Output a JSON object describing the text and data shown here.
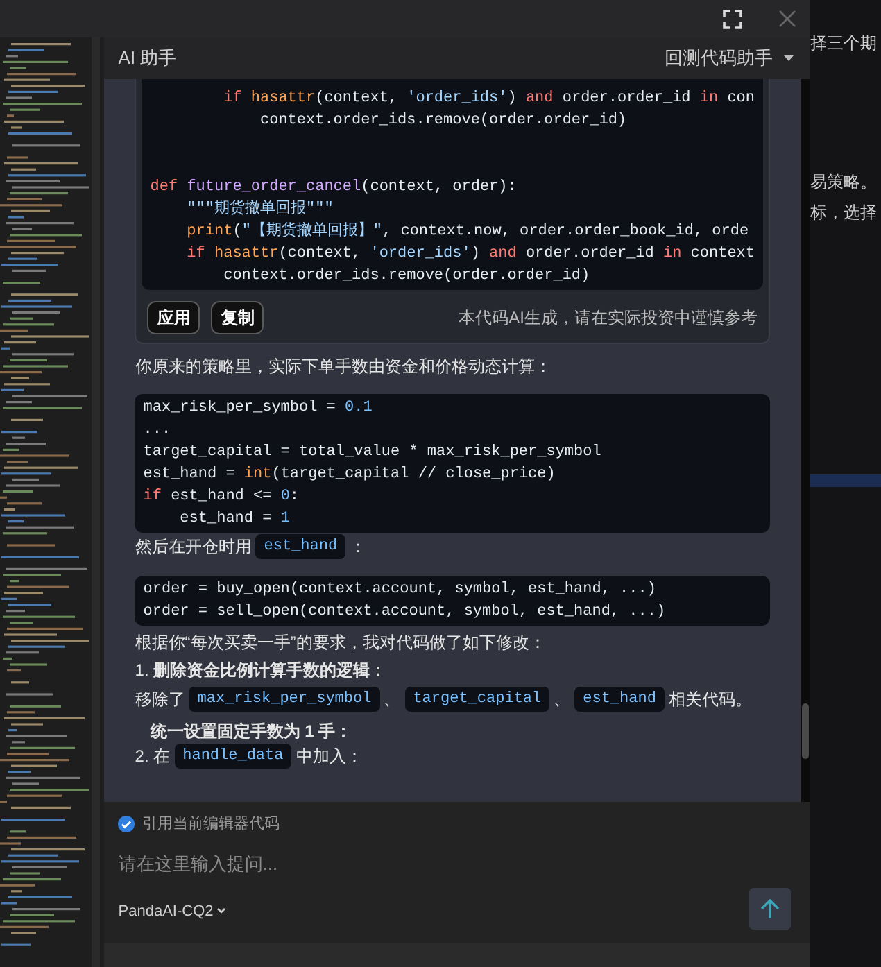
{
  "panel": {
    "title": "AI 助手",
    "mode_dropdown": "回测代码助手"
  },
  "messages": [
    {
      "kind": "code_card",
      "lines": [
        {
          "kind": "code",
          "tokens": [
            {
              "kind": "kw",
              "t": "        if"
            },
            {
              "kind": "builtin",
              "t": " hasattr"
            },
            {
              "kind": "plain",
              "t": "(context, "
            },
            {
              "kind": "str",
              "t": "'order_ids'"
            },
            {
              "kind": "plain",
              "t": ") "
            },
            {
              "kind": "kw",
              "t": "and"
            },
            {
              "kind": "plain",
              "t": " order.order_id "
            },
            {
              "kind": "kw",
              "t": "in"
            },
            {
              "kind": "plain",
              "t": " con"
            }
          ]
        },
        {
          "kind": "code",
          "tokens": [
            {
              "kind": "plain",
              "t": "            context.order_ids.remove(order.order_id)"
            }
          ]
        },
        {
          "kind": "blank"
        },
        {
          "kind": "blank"
        },
        {
          "kind": "code",
          "tokens": [
            {
              "kind": "kw",
              "t": "def"
            },
            {
              "kind": "fn",
              "t": " future_order_cancel"
            },
            {
              "kind": "plain",
              "t": "(context, order):"
            }
          ]
        },
        {
          "kind": "code",
          "tokens": [
            {
              "kind": "str",
              "t": "    \"\"\"期货撤单回报\"\"\""
            }
          ]
        },
        {
          "kind": "code",
          "tokens": [
            {
              "kind": "builtin",
              "t": "    print"
            },
            {
              "kind": "plain",
              "t": "("
            },
            {
              "kind": "str",
              "t": "\"【期货撤单回报】\""
            },
            {
              "kind": "plain",
              "t": ", context.now, order.order_book_id, orde"
            }
          ]
        },
        {
          "kind": "code",
          "tokens": [
            {
              "kind": "kw",
              "t": "    if"
            },
            {
              "kind": "builtin",
              "t": " hasattr"
            },
            {
              "kind": "plain",
              "t": "(context, "
            },
            {
              "kind": "str",
              "t": "'order_ids'"
            },
            {
              "kind": "plain",
              "t": ") "
            },
            {
              "kind": "kw",
              "t": "and"
            },
            {
              "kind": "plain",
              "t": " order.order_id "
            },
            {
              "kind": "kw",
              "t": "in"
            },
            {
              "kind": "plain",
              "t": " context"
            }
          ]
        },
        {
          "kind": "code",
          "tokens": [
            {
              "kind": "plain",
              "t": "        context.order_ids.remove(order.order_id)"
            }
          ]
        }
      ],
      "buttons": [
        "应用",
        "复制"
      ],
      "note": "本代码AI生成，请在实际投资中谨慎参考"
    },
    {
      "kind": "text",
      "text": "你原来的策略里，实际下单手数由资金和价格动态计算："
    },
    {
      "kind": "code",
      "lines": [
        {
          "kind": "code",
          "tokens": [
            {
              "kind": "plain",
              "t": "max_risk_per_symbol = "
            },
            {
              "kind": "num",
              "t": "0.1"
            }
          ]
        },
        {
          "kind": "code",
          "tokens": [
            {
              "kind": "plain",
              "t": "..."
            }
          ]
        },
        {
          "kind": "code",
          "tokens": [
            {
              "kind": "plain",
              "t": "target_capital = total_value * max_risk_per_symbol"
            }
          ]
        },
        {
          "kind": "code",
          "tokens": [
            {
              "kind": "plain",
              "t": "est_hand = "
            },
            {
              "kind": "builtin",
              "t": "int"
            },
            {
              "kind": "plain",
              "t": "(target_capital // close_price)"
            }
          ]
        },
        {
          "kind": "code",
          "tokens": [
            {
              "kind": "kw",
              "t": "if"
            },
            {
              "kind": "plain",
              "t": " est_hand <= "
            },
            {
              "kind": "num",
              "t": "0"
            },
            {
              "kind": "plain",
              "t": ":"
            }
          ]
        },
        {
          "kind": "code",
          "tokens": [
            {
              "kind": "plain",
              "t": "    est_hand = "
            },
            {
              "kind": "num",
              "t": "1"
            }
          ]
        }
      ]
    },
    {
      "kind": "mixed",
      "segments": [
        {
          "kind": "text",
          "t": "然后在开仓时用"
        },
        {
          "kind": "code",
          "t": "est_hand"
        },
        {
          "kind": "text",
          "t": "："
        }
      ]
    },
    {
      "kind": "code",
      "lines": [
        {
          "kind": "code",
          "tokens": [
            {
              "kind": "plain",
              "t": "order = buy_open(context.account, symbol, est_hand, ...)"
            }
          ]
        },
        {
          "kind": "code",
          "tokens": [
            {
              "kind": "plain",
              "t": "order = sell_open(context.account, symbol, est_hand, ...)"
            }
          ]
        }
      ]
    },
    {
      "kind": "text",
      "text": "根据你“每次买卖一手”的要求，我对代码做了如下修改："
    },
    {
      "kind": "text",
      "text": "1. **删除资金比例计算手数的逻辑：**"
    },
    {
      "kind": "mixed",
      "segments": [
        {
          "kind": "text",
          "t": "移除了"
        },
        {
          "kind": "code",
          "t": "max_risk_per_symbol"
        },
        {
          "kind": "text",
          "t": "、"
        },
        {
          "kind": "code",
          "t": "target_capital"
        },
        {
          "kind": "text",
          "t": "、"
        },
        {
          "kind": "code",
          "t": "est_hand"
        },
        {
          "kind": "text",
          "t": "相关代码。"
        }
      ]
    },
    {
      "kind": "heading",
      "text": "统一设置固定手数为 1 手："
    },
    {
      "kind": "mixed",
      "segments": [
        {
          "kind": "text",
          "t": "2. 在"
        },
        {
          "kind": "code",
          "t": "handle_data"
        },
        {
          "kind": "text",
          "t": "中加入："
        }
      ]
    }
  ],
  "composer": {
    "quote_editor": {
      "label": "引用当前编辑器代码",
      "checked": true
    },
    "placeholder": "请在这里输入提问...",
    "model": "PandaAI-CQ2"
  },
  "background_page": {
    "texts": [
      "择三个期",
      "易策略。",
      "标，选择"
    ]
  }
}
